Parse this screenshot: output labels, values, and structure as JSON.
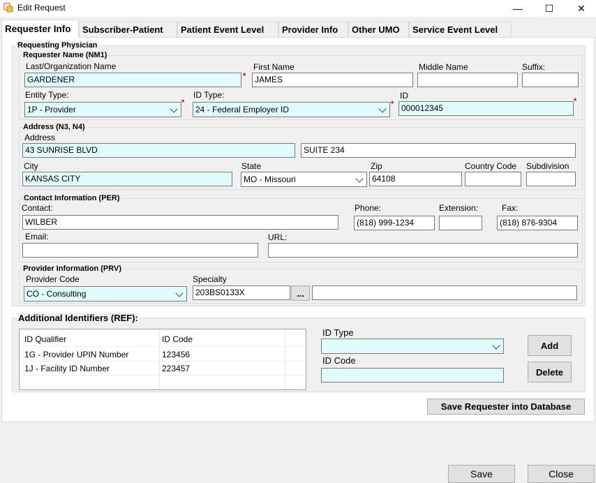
{
  "window": {
    "title": "Edit Request",
    "minimize": "—",
    "maximize": "☐",
    "close": "✕"
  },
  "tabs": [
    {
      "label": "Requester Info"
    },
    {
      "label": "Subscriber-Patient"
    },
    {
      "label": "Patient Event Level"
    },
    {
      "label": "Provider Info"
    },
    {
      "label": "Other UMO"
    },
    {
      "label": "Service Event Level"
    }
  ],
  "requesting_physician": {
    "group_title": "Requesting Physician",
    "name_group": {
      "title": "Requester Name (NM1)",
      "last_label": "Last/Organization Name",
      "last_value": "GARDENER",
      "first_label": "First Name",
      "first_value": "JAMES",
      "middle_label": "Middle Name",
      "middle_value": "",
      "suffix_label": "Suffix:",
      "suffix_value": "",
      "entity_type_label": "Entity Type:",
      "entity_type_value": "1P - Provider",
      "id_type_label": "ID Type:",
      "id_type_value": "24 - Federal Employer ID",
      "id_label": "ID",
      "id_value": "000012345",
      "required_mark": "*"
    },
    "address_group": {
      "title": "Address (N3, N4)",
      "address_label": "Address",
      "address1_value": "43 SUNRISE BLVD",
      "address2_value": "SUITE 234",
      "city_label": "City",
      "city_value": "KANSAS CITY",
      "state_label": "State",
      "state_value": "MO - Missouri",
      "zip_label": "Zip",
      "zip_value": "64108",
      "country_label": "Country Code",
      "country_value": "",
      "subdivision_label": "Subdivision",
      "subdivision_value": ""
    },
    "contact_group": {
      "title": "Contact Information (PER)",
      "contact_label": "Contact:",
      "contact_value": "WILBER",
      "phone_label": "Phone:",
      "phone_value": "(818) 999-1234",
      "extension_label": "Extension:",
      "extension_value": "",
      "fax_label": "Fax:",
      "fax_value": "(818) 876-9304",
      "email_label": "Email:",
      "email_value": "",
      "url_label": "URL:",
      "url_value": ""
    },
    "provider_group": {
      "title": "Provider Information (PRV)",
      "code_label": "Provider Code",
      "code_value": "CO - Consulting",
      "specialty_label": "Specialty",
      "specialty_value": "203BS0133X",
      "browse_label": "...",
      "specialty_desc_value": ""
    }
  },
  "additional_identifiers": {
    "title": "Additional Identifiers (REF):",
    "columns": [
      "ID Qualifier",
      "ID Code"
    ],
    "rows": [
      {
        "qualifier": "1G - Provider UPIN Number",
        "code": "123456"
      },
      {
        "qualifier": "1J - Facility ID Number",
        "code": "223457"
      }
    ],
    "id_type_label": "ID Type",
    "id_type_value": "",
    "id_code_label": "ID Code",
    "id_code_value": "",
    "add_label": "Add",
    "delete_label": "Delete"
  },
  "save_requester_label": "Save Requester into Database",
  "footer": {
    "save_label": "Save",
    "close_label": "Close"
  }
}
